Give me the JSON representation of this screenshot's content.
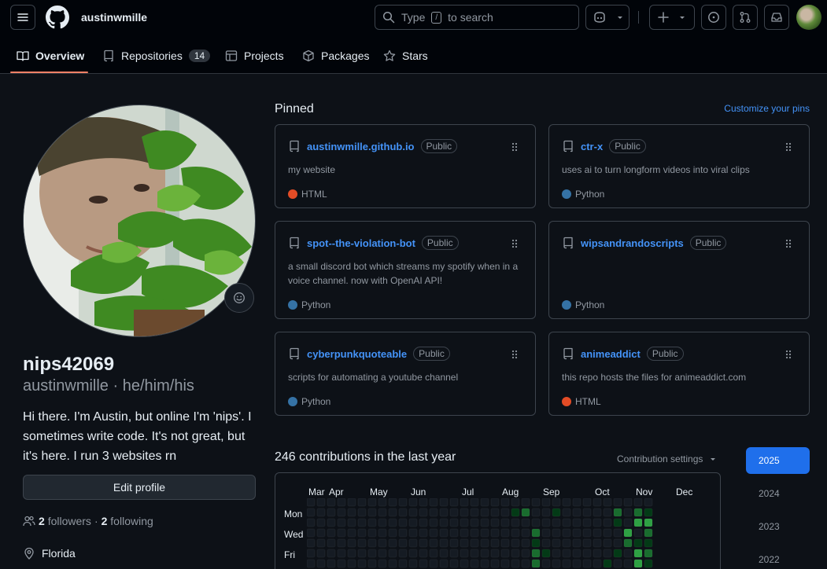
{
  "header": {
    "username": "austinwmille",
    "search_placeholder_before": "Type",
    "search_key": "/",
    "search_placeholder_after": "to search"
  },
  "tabs": [
    {
      "label": "Overview"
    },
    {
      "label": "Repositories",
      "count": "14"
    },
    {
      "label": "Projects"
    },
    {
      "label": "Packages"
    },
    {
      "label": "Stars"
    }
  ],
  "profile": {
    "display_name": "nips42069",
    "login": "austinwmille",
    "pronouns": "he/him/his",
    "separator": "·",
    "bio": "Hi there. I'm Austin, but online I'm 'nips'. I sometimes write code. It's not great, but it's here. I run 3 websites rn",
    "edit_button": "Edit profile",
    "followers_count": "2",
    "followers_label": "followers",
    "dot": "·",
    "following_count": "2",
    "following_label": "following",
    "location": "Florida"
  },
  "pinned": {
    "title": "Pinned",
    "customize": "Customize your pins",
    "repos": [
      {
        "name": "austinwmille.github.io",
        "visibility": "Public",
        "description": "my website",
        "language": "HTML",
        "lang_color": "#e34c26"
      },
      {
        "name": "ctr-x",
        "visibility": "Public",
        "description": "uses ai to turn longform videos into viral clips",
        "language": "Python",
        "lang_color": "#3572A5"
      },
      {
        "name": "spot--the-violation-bot",
        "visibility": "Public",
        "description": "a small discord bot which streams my spotify when in a voice channel. now with OpenAI API!",
        "language": "Python",
        "lang_color": "#3572A5"
      },
      {
        "name": "wipsandrandoscripts",
        "visibility": "Public",
        "description": "",
        "language": "Python",
        "lang_color": "#3572A5"
      },
      {
        "name": "cyberpunkquoteable",
        "visibility": "Public",
        "description": "scripts for automating a youtube channel",
        "language": "Python",
        "lang_color": "#3572A5"
      },
      {
        "name": "animeaddict",
        "visibility": "Public",
        "description": "this repo hosts the files for animeaddict.com",
        "language": "HTML",
        "lang_color": "#e34c26"
      }
    ]
  },
  "contributions": {
    "heading": "246 contributions in the last year",
    "settings": "Contribution settings",
    "months": [
      "Mar",
      "Apr",
      "May",
      "Jun",
      "Jul",
      "Aug",
      "Sep",
      "Oct",
      "Nov",
      "Dec"
    ],
    "days": [
      "Mon",
      "Wed",
      "Fri"
    ],
    "levels": [
      "0000000000000000000000000000000000",
      "0000000000000000000012001000002021",
      "0000000000000000000000000000001033",
      "0000000000000000000000200000000302",
      "0000000000000000000000100000000211",
      "0000000000000000000000210000001032",
      "0000000000000000000000200000010031"
    ],
    "level_colors": [
      "#151b23",
      "#033a16",
      "#196c2e",
      "#2ea043",
      "#56d364"
    ]
  },
  "years": [
    "2025",
    "2024",
    "2023",
    "2022"
  ],
  "icons": [
    "hamburger-icon",
    "github-logo-icon",
    "search-icon",
    "copilot-icon",
    "plus-icon",
    "issues-icon",
    "pull-request-icon",
    "inbox-icon",
    "book-icon",
    "repo-icon",
    "table-icon",
    "package-icon",
    "star-icon",
    "smiley-icon",
    "people-icon",
    "location-icon",
    "grabber-icon",
    "triangle-down-icon"
  ]
}
